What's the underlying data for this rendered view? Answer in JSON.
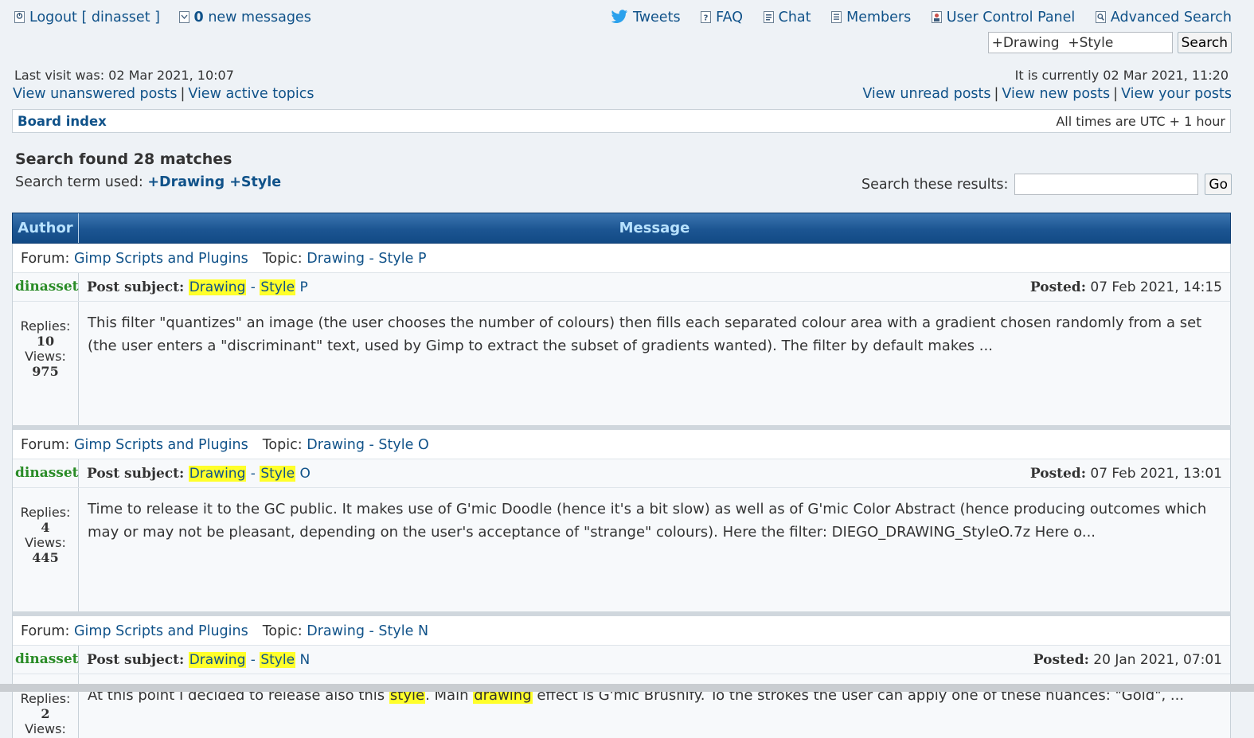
{
  "header": {
    "logout_label": "Logout",
    "username": "dinasset",
    "new_messages_count": "0",
    "new_messages_label": "new messages",
    "nav": [
      {
        "label": "Tweets",
        "icon": "twitter-icon"
      },
      {
        "label": "FAQ",
        "icon": "faq-icon"
      },
      {
        "label": "Chat",
        "icon": "chat-icon"
      },
      {
        "label": "Members",
        "icon": "members-icon"
      },
      {
        "label": "User Control Panel",
        "icon": "user-control-panel-icon"
      },
      {
        "label": "Advanced Search",
        "icon": "advanced-search-icon"
      }
    ],
    "search_value": "+Drawing  +Style",
    "search_button": "Search"
  },
  "info": {
    "last_visit": "Last visit was: 02 Mar 2021, 10:07",
    "current_time": "It is currently 02 Mar 2021, 11:20",
    "view_unanswered": "View unanswered posts",
    "view_active": "View active topics",
    "view_unread": "View unread posts",
    "view_new": "View new posts",
    "view_yours": "View your posts",
    "separator": "|"
  },
  "navbar": {
    "board_index": "Board index",
    "timezone": "All times are UTC + 1 hour"
  },
  "search": {
    "found_label": "Search found 28 matches",
    "term_label": "Search term used:",
    "term_value": "+Drawing +Style",
    "these_results_label": "Search these results:",
    "go_button": "Go"
  },
  "table": {
    "author_header": "Author",
    "message_header": "Message",
    "forum_label": "Forum:",
    "topic_label": "Topic:",
    "subject_label": "Post subject:",
    "posted_label": "Posted:",
    "replies_label": "Replies:",
    "views_label": "Views:",
    "subject_word1": "Drawing",
    "subject_dash": "-",
    "subject_word2": "Style",
    "results": [
      {
        "forum": "Gimp Scripts and Plugins",
        "topic": "Drawing - Style P",
        "author": "dinasset",
        "subject_suffix": "P",
        "posted": "07 Feb 2021, 14:15",
        "replies": "10",
        "views": "975",
        "message": "This filter \"quantizes\" an image (the user chooses the number of colours) then fills each separated colour area with a gradient chosen randomly from a set (the user enters a \"discriminant\" text, used by Gimp to extract the subset of gradients wanted). The filter by default makes ..."
      },
      {
        "forum": "Gimp Scripts and Plugins",
        "topic": "Drawing - Style O",
        "author": "dinasset",
        "subject_suffix": "O",
        "posted": "07 Feb 2021, 13:01",
        "replies": "4",
        "views": "445",
        "message": "Time to release it to the GC public. It makes use of G'mic Doodle (hence it's a bit slow) as well as of G'mic Color Abstract (hence producing outcomes which may or may not be pleasant, depending on the user's acceptance of \"strange\" colours). Here the filter: DIEGO_DRAWING_StyleO.7z Here o..."
      },
      {
        "forum": "Gimp Scripts and Plugins",
        "topic": "Drawing - Style N",
        "author": "dinasset",
        "subject_suffix": "N",
        "posted": "20 Jan 2021, 07:01",
        "replies": "2",
        "views": "",
        "message_parts": [
          "At this point I decided to release also this ",
          "style",
          ". Main ",
          "drawing",
          " effect is G'mic Brushify. To the strokes the user can apply one of these nuances: \"Gold\", ..."
        ]
      }
    ]
  }
}
